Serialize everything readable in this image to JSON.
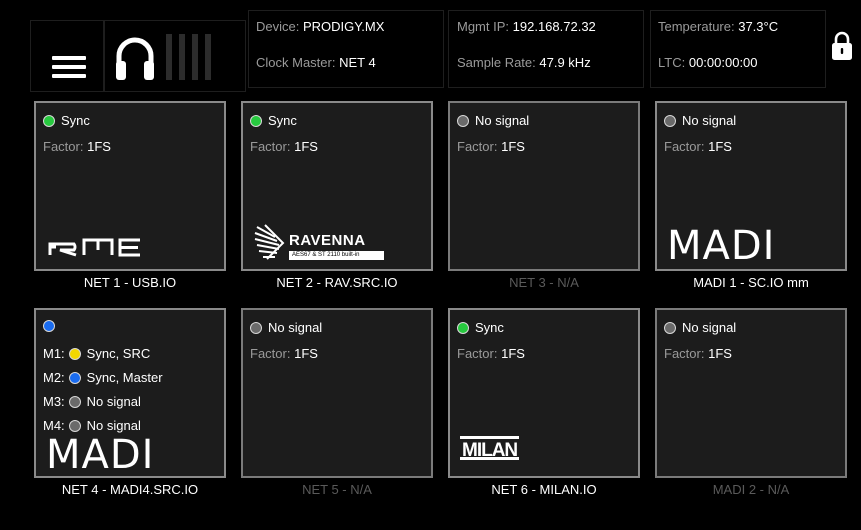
{
  "header": {
    "device_label": "Device:",
    "device_value": "PRODIGY.MX",
    "clock_label": "Clock Master:",
    "clock_value": "NET 4",
    "mgmt_label": "Mgmt IP:",
    "mgmt_value": "192.168.72.32",
    "rate_label": "Sample Rate:",
    "rate_value": "47.9 kHz",
    "temp_label": "Temperature:",
    "temp_value": "37.3°C",
    "ltc_label": "LTC:",
    "ltc_value": "00:00:00:00",
    "icons": [
      "menu-icon",
      "headphones-icon",
      "level-meter-icon",
      "lock-icon"
    ]
  },
  "cards": [
    {
      "name": "NET 1 - USB.IO",
      "status": "Sync",
      "status_color": "#27c93f",
      "factor_label": "Factor:",
      "factor_value": "1FS",
      "logo": "RME",
      "available": true
    },
    {
      "name": "NET 2 - RAV.SRC.IO",
      "status": "Sync",
      "status_color": "#27c93f",
      "factor_label": "Factor:",
      "factor_value": "1FS",
      "logo": "RAVENNA",
      "logo_sub": "AES67 & ST 2110 built-in",
      "available": true
    },
    {
      "name": "NET 3 - N/A",
      "status": "No signal",
      "status_color": "#6a6a6a",
      "factor_label": "Factor:",
      "factor_value": "1FS",
      "available": false
    },
    {
      "name": "MADI 1 - SC.IO mm",
      "status": "No signal",
      "status_color": "#6a6a6a",
      "factor_label": "Factor:",
      "factor_value": "1FS",
      "logo": "MADI",
      "available": true
    },
    {
      "name": "NET 4 - MADI4.SRC.IO",
      "status_color": "#1a6cf0",
      "logo": "MADI",
      "available": true,
      "ports": [
        {
          "label": "M1:",
          "status": "Sync, SRC",
          "color": "#f2d600"
        },
        {
          "label": "M2:",
          "status": "Sync, Master",
          "color": "#1a6cf0"
        },
        {
          "label": "M3:",
          "status": "No signal",
          "color": "#6a6a6a"
        },
        {
          "label": "M4:",
          "status": "No signal",
          "color": "#6a6a6a"
        }
      ]
    },
    {
      "name": "NET 5 - N/A",
      "status": "No signal",
      "status_color": "#6a6a6a",
      "factor_label": "Factor:",
      "factor_value": "1FS",
      "available": false
    },
    {
      "name": "NET 6 - MILAN.IO",
      "status": "Sync",
      "status_color": "#27c93f",
      "factor_label": "Factor:",
      "factor_value": "1FS",
      "logo": "MILAN",
      "available": true
    },
    {
      "name": "MADI 2 - N/A",
      "status": "No signal",
      "status_color": "#6a6a6a",
      "factor_label": "Factor:",
      "factor_value": "1FS",
      "available": false
    }
  ]
}
